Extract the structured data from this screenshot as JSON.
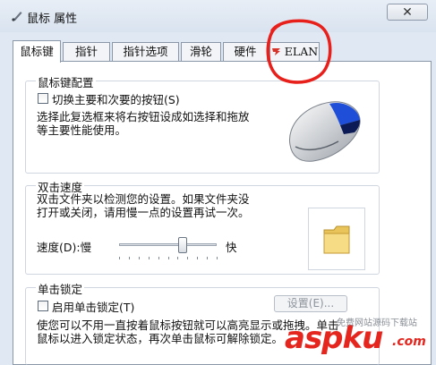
{
  "window": {
    "title": "鼠标 属性",
    "close_symbol": "✕"
  },
  "tabs": [
    {
      "label": "鼠标键",
      "active": true
    },
    {
      "label": "指针",
      "active": false
    },
    {
      "label": "指针选项",
      "active": false
    },
    {
      "label": "滑轮",
      "active": false
    },
    {
      "label": "硬件",
      "active": false
    },
    {
      "label": "ELAN",
      "active": false
    }
  ],
  "button_config": {
    "group_title": "鼠标键配置",
    "checkbox_label": "切换主要和次要的按钮(S)",
    "checked": false,
    "description": [
      "选择此复选框来将右按钮设成如选择和拖放",
      "等主要性能使用。"
    ]
  },
  "double_click": {
    "group_title": "双击速度",
    "description": [
      "双击文件夹以检测您的设置。如果文件夹没",
      "打开或关闭，请用慢一点的设置再试一次。"
    ],
    "speed_label": "速度(D):慢",
    "fast_label": "快",
    "speed_value": 0.65
  },
  "click_lock": {
    "group_title": "单击锁定",
    "checkbox_label": "启用单击锁定(T)",
    "checked": false,
    "settings_button": "设置(E)...",
    "description": [
      "使您可以不用一直按着鼠标按钮就可以高亮显示或拖拽。单击",
      "鼠标以进入锁定状态，再次单击鼠标可解除锁定。"
    ]
  },
  "watermark": {
    "brand": "aspku",
    "tld": ".com",
    "tagline": "免费网站源码下载站"
  },
  "colors": {
    "annotation_red": "#e8201c",
    "watermark_red": "#e4261f",
    "elan_icon_red": "#d6332a"
  }
}
